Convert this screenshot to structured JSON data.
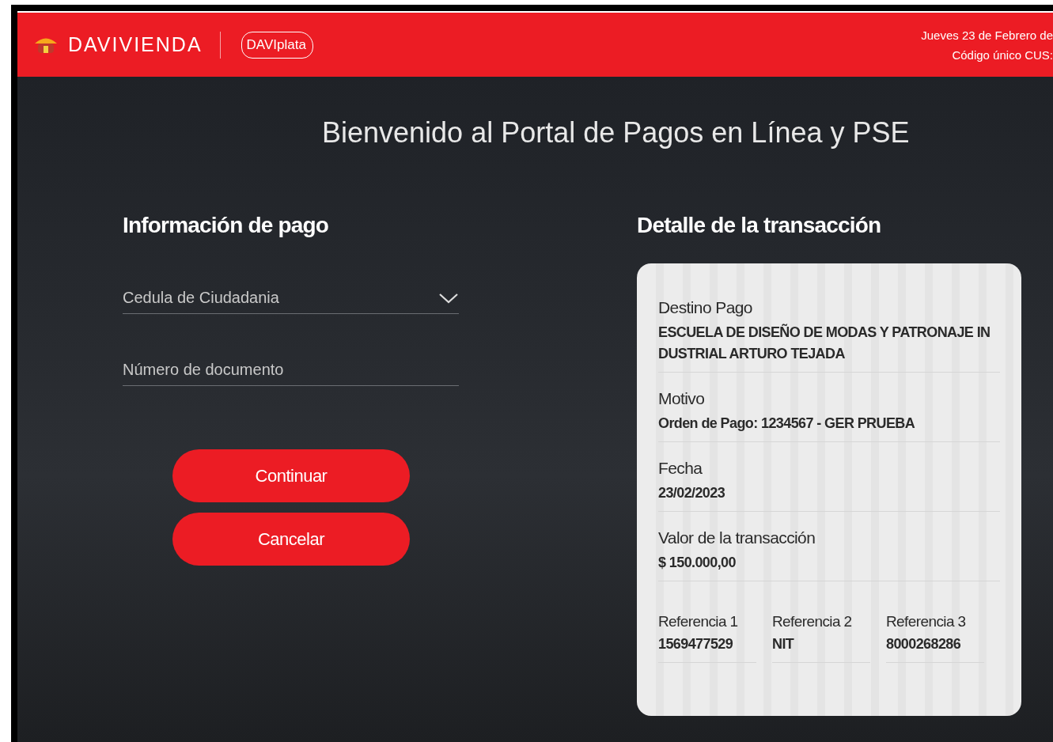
{
  "header": {
    "brand": "DAVIVIENDA",
    "sub_brand": "DAVIplata",
    "date": "Jueves 23 de Febrero de",
    "cus_label": "Código único CUS:"
  },
  "title": "Bienvenido al Portal de Pagos en Línea y PSE",
  "payment_info": {
    "heading": "Información de pago",
    "document_type": {
      "value": "Cedula de Ciudadania"
    },
    "document_number": {
      "placeholder": "Número de documento"
    },
    "buttons": [
      "Continuar",
      "Cancelar"
    ]
  },
  "transaction_detail": {
    "heading": "Detalle de la transacción",
    "fields": [
      {
        "label": "Destino Pago",
        "value": "ESCUELA DE DISEÑO DE MODAS Y PATRONAJE IN DUSTRIAL ARTURO TEJADA"
      },
      {
        "label": "Motivo",
        "value": "Orden de Pago: 1234567 - GER PRUEBA"
      },
      {
        "label": "Fecha",
        "value": "23/02/2023"
      },
      {
        "label": "Valor de la transacción",
        "value": "$ 150.000,00"
      }
    ],
    "references": [
      {
        "label": "Referencia 1",
        "value": "1569477529"
      },
      {
        "label": "Referencia 2",
        "value": "NIT"
      },
      {
        "label": "Referencia 3",
        "value": "8000268286"
      }
    ]
  }
}
